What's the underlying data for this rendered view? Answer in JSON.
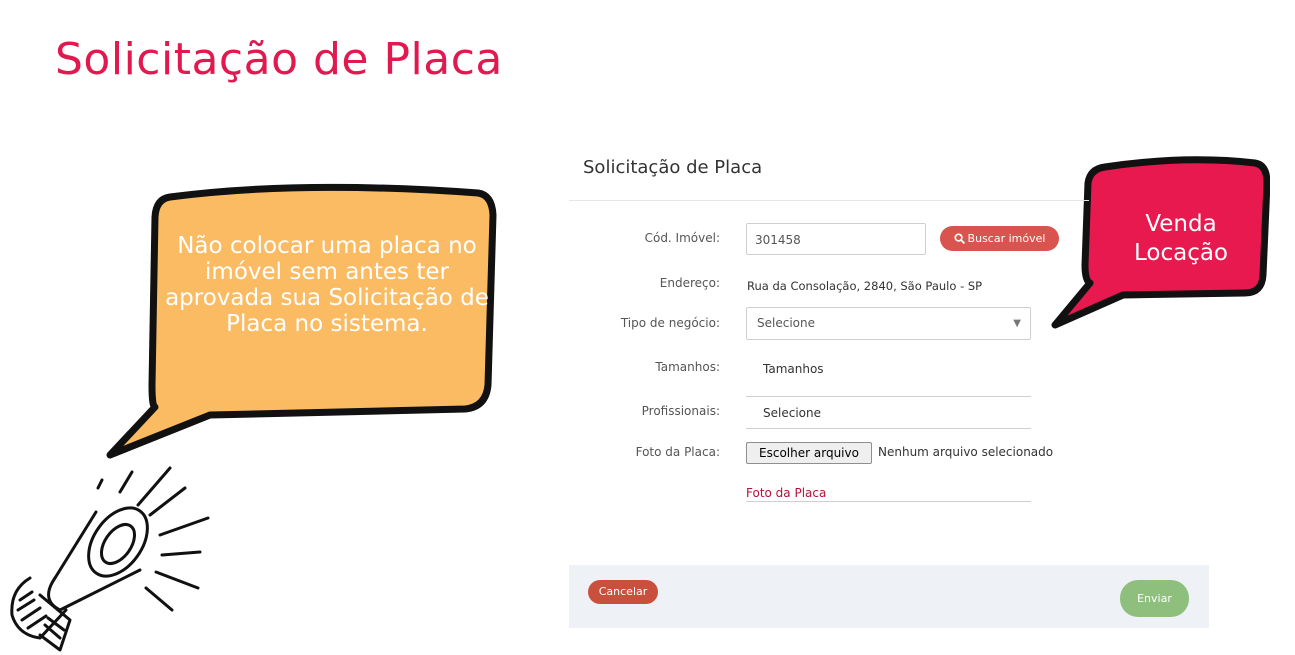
{
  "slide": {
    "title": "Solicitação de Placa"
  },
  "callouts": {
    "left_text": "Não colocar uma placa no imóvel sem antes ter aprovada sua Solicitação de Placa no sistema.",
    "right_line1": "Venda",
    "right_line2": "Locação",
    "left_color": "#fbbb63",
    "right_color": "#e8194f"
  },
  "form": {
    "title": "Solicitação de Placa",
    "labels": {
      "code": "Cód. Imóvel:",
      "address": "Endereço:",
      "business_type": "Tipo de negócio:",
      "sizes": "Tamanhos:",
      "professionals": "Profissionais:",
      "photo": "Foto da Placa:"
    },
    "code_value": "301458",
    "search_button": "Buscar imóvel",
    "address_value": "Rua da Consolação, 2840, São Paulo - SP",
    "business_type_value": "Selecione",
    "sizes_value": "Tamanhos",
    "professionals_value": "Selecione",
    "file_button": "Escolher arquivo",
    "file_status": "Nenhum arquivo selecionado",
    "photo_field": "Foto da Placa",
    "cancel_button": "Cancelar",
    "send_button": "Enviar"
  }
}
